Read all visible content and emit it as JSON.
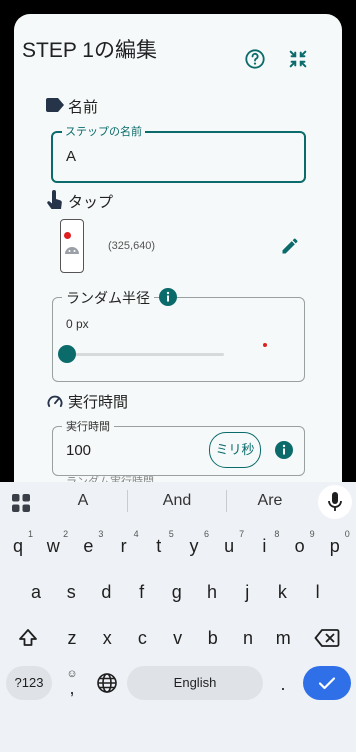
{
  "dialog": {
    "title": "STEP 1の編集",
    "name_section": {
      "label": "名前",
      "field_label": "ステップの名前",
      "value": "A"
    },
    "tap_section": {
      "label": "タップ",
      "coordinates": "(325,640)"
    },
    "random_radius": {
      "label": "ランダム半径",
      "value": "0 px",
      "slider_fraction": 0.0
    },
    "exec_section": {
      "label": "実行時間",
      "field_label": "実行時間",
      "value": "100",
      "unit_button": "ミリ秒"
    },
    "next_label": "ランダム実行時間"
  },
  "keyboard": {
    "suggestions": [
      "A",
      "And",
      "Are"
    ],
    "row1": [
      {
        "k": "q",
        "h": "1"
      },
      {
        "k": "w",
        "h": "2"
      },
      {
        "k": "e",
        "h": "3"
      },
      {
        "k": "r",
        "h": "4"
      },
      {
        "k": "t",
        "h": "5"
      },
      {
        "k": "y",
        "h": "6"
      },
      {
        "k": "u",
        "h": "7"
      },
      {
        "k": "i",
        "h": "8"
      },
      {
        "k": "o",
        "h": "9"
      },
      {
        "k": "p",
        "h": "0"
      }
    ],
    "row2": [
      "a",
      "s",
      "d",
      "f",
      "g",
      "h",
      "j",
      "k",
      "l"
    ],
    "row3": [
      "z",
      "x",
      "c",
      "v",
      "b",
      "n",
      "m"
    ],
    "symbols_key": "?123",
    "comma_key": ",",
    "space_label": "English",
    "period_key": "."
  },
  "colors": {
    "accent": "#0b6b6b",
    "enter": "#2f6fe8",
    "dot": "#e02020"
  }
}
